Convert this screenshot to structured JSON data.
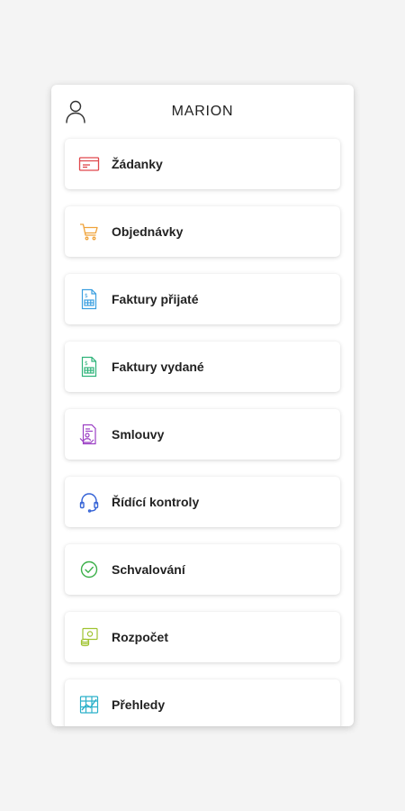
{
  "app": {
    "title": "MARION"
  },
  "menu": [
    {
      "label": "Žádanky",
      "icon": "request-card-icon",
      "color": "#e0474c"
    },
    {
      "label": "Objednávky",
      "icon": "shopping-cart-icon",
      "color": "#f0a33a"
    },
    {
      "label": "Faktury přijaté",
      "icon": "received-invoice-icon",
      "color": "#3b9fe0"
    },
    {
      "label": "Faktury vydané",
      "icon": "issued-invoice-icon",
      "color": "#2fb37a"
    },
    {
      "label": "Smlouvy",
      "icon": "contract-icon",
      "color": "#9b3fc4"
    },
    {
      "label": "Řídící kontroly",
      "icon": "headset-icon",
      "color": "#3563d6"
    },
    {
      "label": "Schvalování",
      "icon": "check-circle-icon",
      "color": "#3cb04a"
    },
    {
      "label": "Rozpočet",
      "icon": "budget-icon",
      "color": "#9fc32f"
    },
    {
      "label": "Přehledy",
      "icon": "chart-table-icon",
      "color": "#2bb0c9"
    }
  ]
}
